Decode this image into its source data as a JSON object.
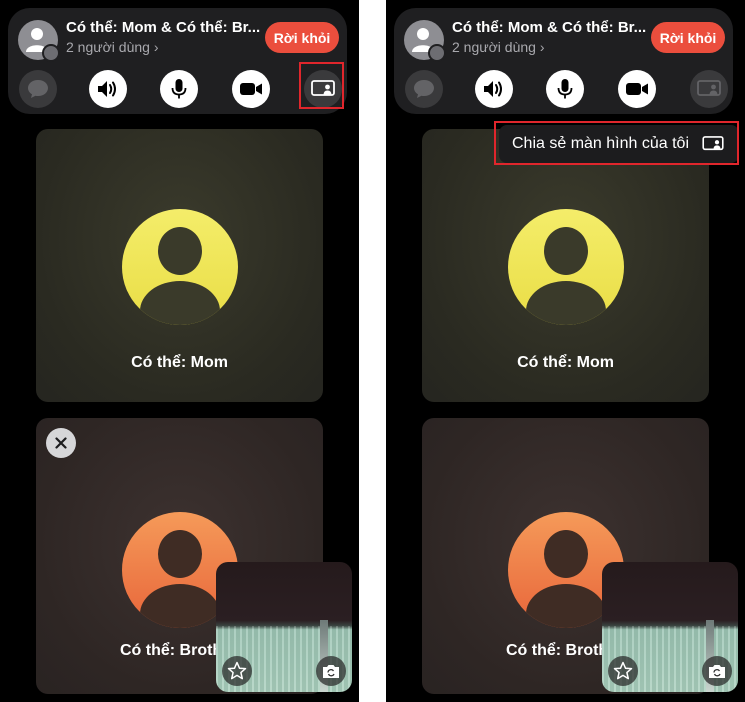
{
  "call": {
    "title": "Có thể: Mom & Có thể: Br...",
    "participants": "2 người dùng ›",
    "leave_label": "Rời khỏi"
  },
  "tiles": {
    "mom_name": "Có thể: Mom",
    "brother_name": "Có thể: Broth"
  },
  "share_menu": {
    "label": "Chia sẻ màn hình của tôi"
  },
  "colors": {
    "leave_red": "#eb4e3d",
    "highlight_red": "#e0262c",
    "mom_avatar": "#f4ed6a",
    "brother_avatar": "#f59a59"
  },
  "icons": {
    "controls": [
      "message-icon",
      "speaker-icon",
      "microphone-icon",
      "video-camera-icon",
      "share-screen-icon"
    ],
    "self_view": [
      "effects-star-icon",
      "flip-camera-icon"
    ]
  }
}
